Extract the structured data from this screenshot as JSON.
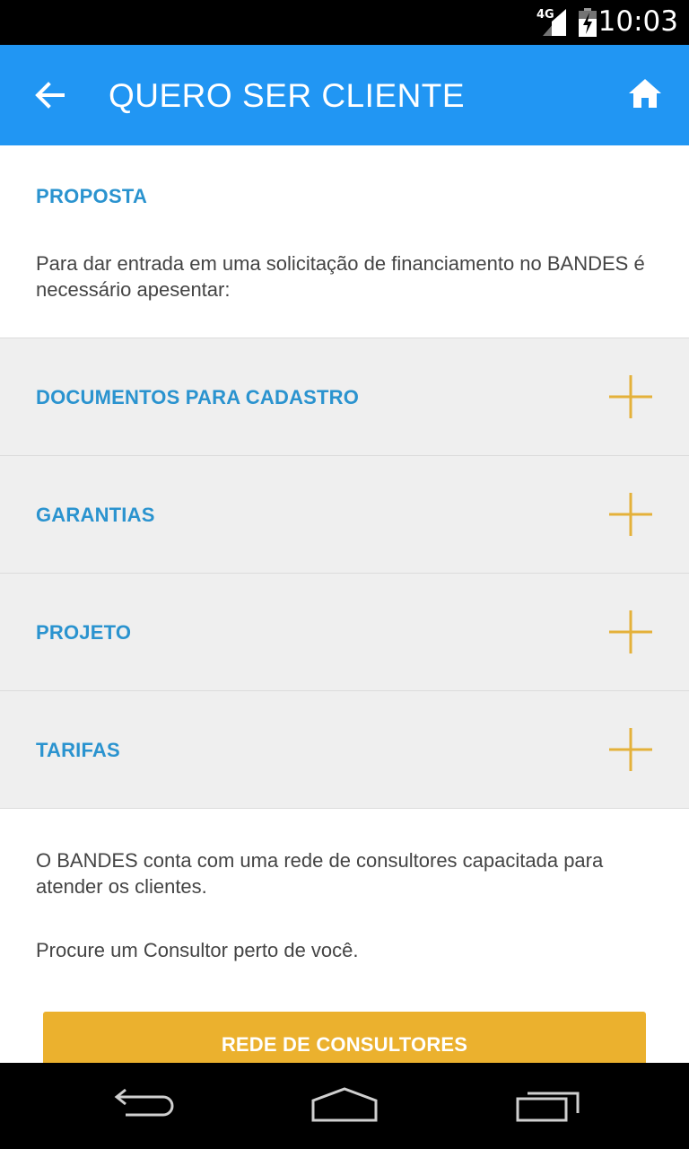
{
  "status_bar": {
    "network": "4G",
    "time": "10:03"
  },
  "app_bar": {
    "back_icon": "arrow-left-icon",
    "title": "QUERO SER CLIENTE",
    "home_icon": "home-icon"
  },
  "section": {
    "title": "PROPOSTA",
    "intro": "Para dar entrada em uma solicitação de financiamento no BANDES é necessário apesentar:"
  },
  "accordion": {
    "expand_icon": "plus-icon",
    "items": [
      {
        "label": "DOCUMENTOS PARA CADASTRO"
      },
      {
        "label": "GARANTIAS"
      },
      {
        "label": "PROJETO"
      },
      {
        "label": "TARIFAS"
      }
    ]
  },
  "footer_text": {
    "consultants": "O BANDES conta com uma rede de consultores capacitada para atender os clientes.",
    "find": "Procure um Consultor perto de você."
  },
  "cta_button": {
    "label": "REDE DE CONSULTORES"
  },
  "colors": {
    "app_bar": "#2196f3",
    "accent_text": "#2a93cf",
    "plus_icon": "#e4b13a",
    "button": "#ebb12e",
    "accordion_bg": "#efefef"
  },
  "nav_bar": {
    "back_icon": "nav-back-icon",
    "home_icon": "nav-home-icon",
    "recents_icon": "nav-recents-icon"
  }
}
